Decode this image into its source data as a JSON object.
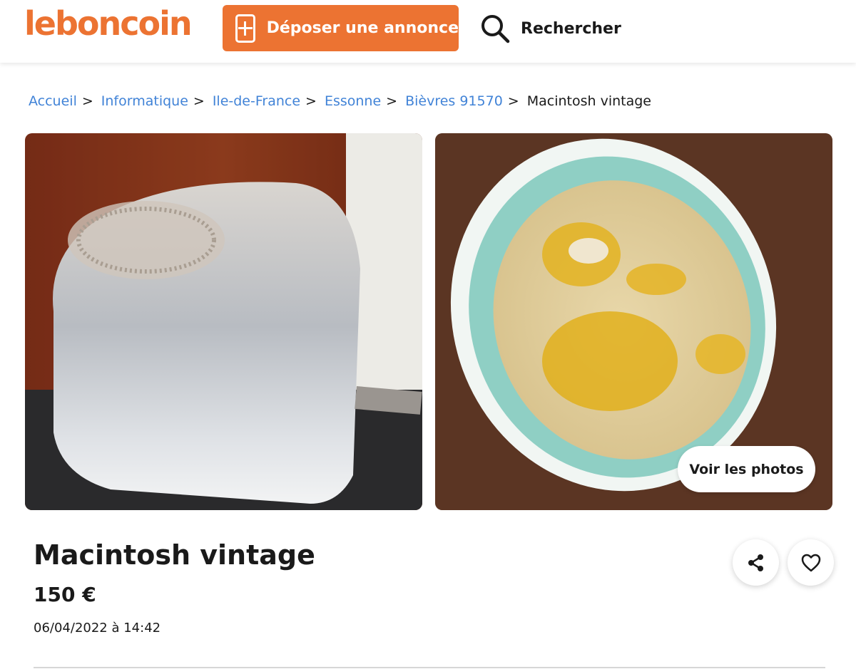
{
  "colors": {
    "brand": "#ec7332",
    "link": "#4183d7",
    "text": "#1a1a1a"
  },
  "header": {
    "logo_text": "leboncoin",
    "post_button_label": "Déposer une annonce",
    "post_button_icon": "plus-square-icon",
    "search_label": "Rechercher",
    "search_icon": "magnifier-icon"
  },
  "breadcrumb": {
    "items": [
      "Accueil",
      "Informatique",
      "Ile-de-France",
      "Essonne",
      "Bièvres 91570"
    ],
    "separator": ">",
    "current": "Macintosh vintage"
  },
  "gallery": {
    "photos": [
      {
        "subject": "iMac G3 translucent casing"
      },
      {
        "subject": "bowl of hummus with olive oil"
      }
    ],
    "view_photos_label": "Voir les photos"
  },
  "ad": {
    "title": "Macintosh vintage",
    "price": "150 €",
    "date": "06/04/2022 à 14:42",
    "share_icon": "share-icon",
    "favorite_icon": "heart-icon"
  }
}
